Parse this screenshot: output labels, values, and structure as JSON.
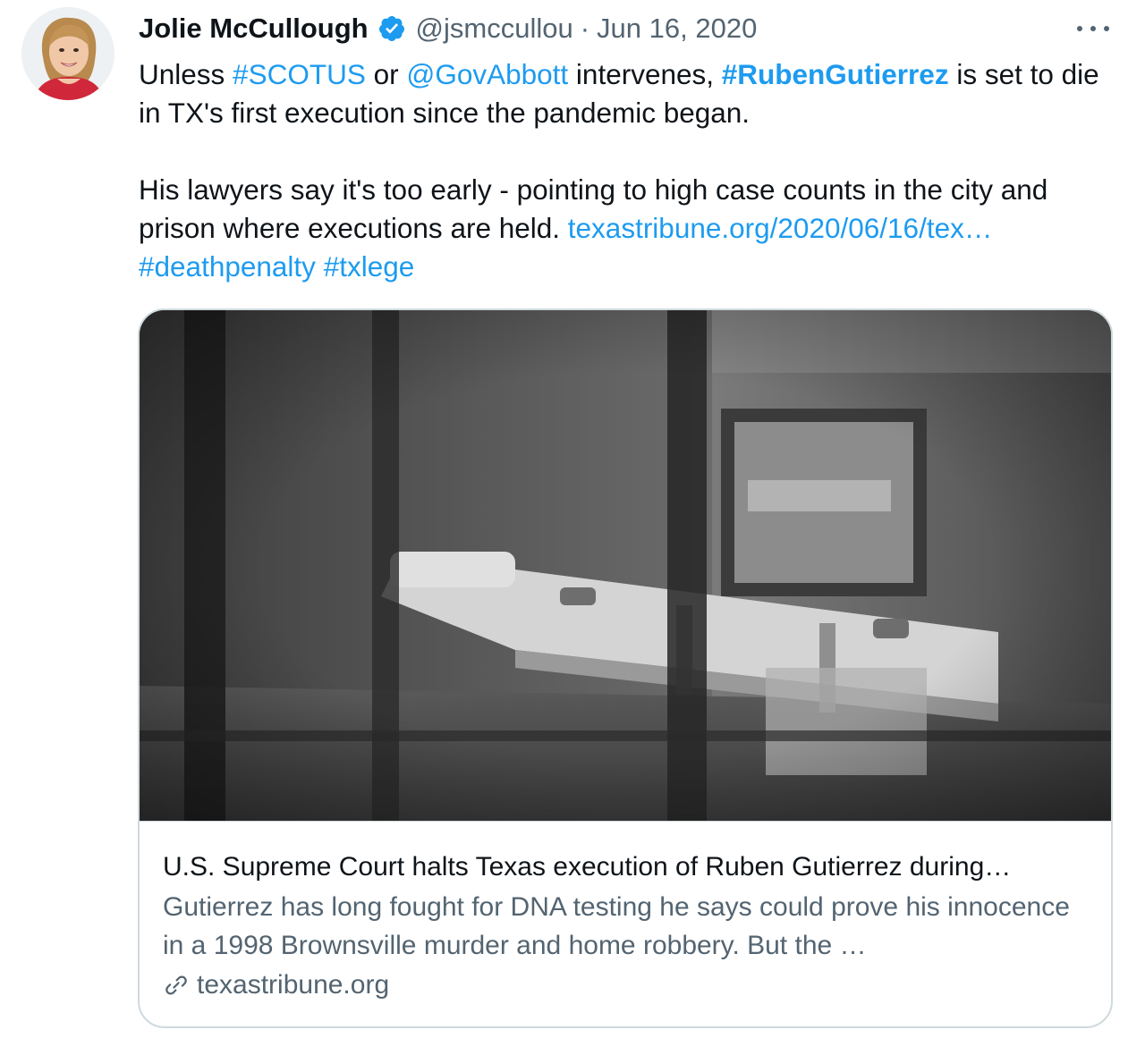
{
  "author": {
    "name": "Jolie McCullough",
    "handle": "@jsmccullou",
    "separator": "·",
    "date": "Jun 16, 2020",
    "avatar_icon": "avatar-photo",
    "verified_icon": "verified-badge-icon"
  },
  "tweet": {
    "line1": {
      "t1": "Unless ",
      "h1": "#SCOTUS",
      "t2": " or ",
      "m1": "@GovAbbott",
      "t3": " intervenes, ",
      "h2": "#RubenGutierrez",
      "t4": " is set to die in TX's first execution since the pandemic began."
    },
    "line2": {
      "t1": "His lawyers say it's too early - pointing to high case counts in the city and prison where executions are held. ",
      "url": "texastribune.org/2020/06/16/tex…",
      "h1": "#deathpenalty",
      "h2": "#txlege"
    }
  },
  "card": {
    "title": "U.S. Supreme Court halts Texas execution of Ruben Gutierrez during…",
    "description": "Gutierrez has long fought for DNA testing he says could prove his innocence in a 1998 Brownsville murder and home robbery. But the …",
    "domain": "texastribune.org",
    "domain_icon": "link-icon",
    "image": "execution-chamber-photo"
  },
  "colors": {
    "link": "#1d9bf0",
    "text": "#0f1419",
    "secondary": "#536471",
    "border": "#cfd9de"
  }
}
